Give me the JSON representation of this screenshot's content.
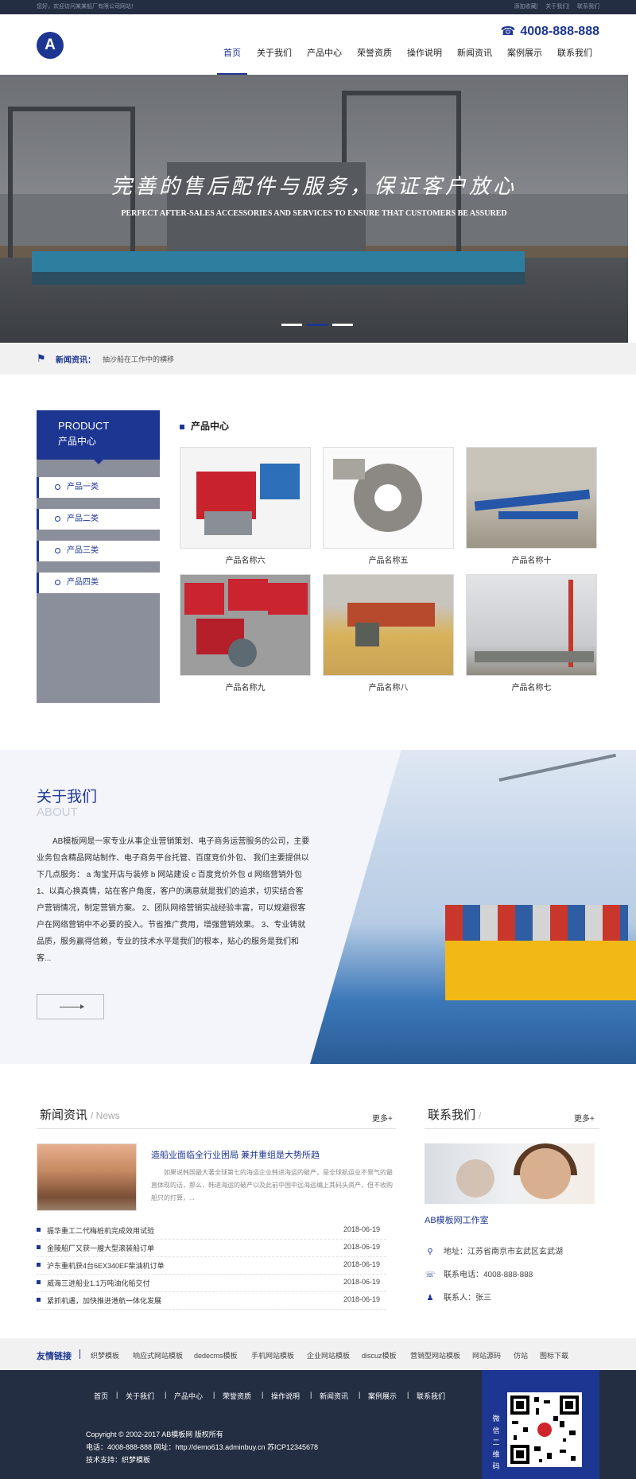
{
  "topbar": {
    "welcome": "您好，欢迎访问某某船厂有限公司网站！",
    "links": [
      "添加收藏",
      "关于我们",
      "联系我们"
    ]
  },
  "header": {
    "logo": "A",
    "phone": "4008-888-888",
    "phone_icon": "phone-icon",
    "nav": [
      "首页",
      "关于我们",
      "产品中心",
      "荣誉资质",
      "操作说明",
      "新闻资讯",
      "案例展示",
      "联系我们"
    ],
    "active_nav": "首页"
  },
  "banner": {
    "slogan": "完善的售后配件与服务，保证客户放心",
    "english": "PERFECT AFTER-SALES ACCESSORIES AND SERVICES TO ENSURE THAT CUSTOMERS BE ASSURED",
    "dots": 3,
    "current_dot": 2
  },
  "ticker": {
    "label": "新闻资讯：",
    "text": "抽沙船在工作中的横移",
    "icon": "tag-icon"
  },
  "sidebar": {
    "title_en": "PRODUCT",
    "title_zh": "产品中心",
    "categories": [
      "产品一类",
      "产品二类",
      "产品三类",
      "产品四类"
    ]
  },
  "products": {
    "title": "产品中心",
    "items": [
      "产品名称六",
      "产品名称五",
      "产品名称十",
      "产品名称九",
      "产品名称八",
      "产品名称七"
    ]
  },
  "about": {
    "title": "关于我们",
    "subtitle": "ABOUT",
    "text": "AB模板网是一家专业从事企业营销策划、电子商务运营服务的公司，主要业务包含精品网站制作、电子商务平台托管、百度竞价外包、 我们主要提供以下几点服务： a 淘宝开店与装修 b 网站建设 c 百度竞价外包 d 网络营销外包 1、以真心换真情，站在客户角度，客户的满意就是我们的追求，切实结合客户营销情况，制定营销方案。 2、团队网络营销实战经验丰富，可以规避很客户在网络营销中不必要的投入。节省推广费用，增强营销效果。 3、专业铸就品质，服务赢得信赖，专业的技术水平是我们的根本，贴心的服务是我们和客..."
  },
  "news": {
    "title": "新闻资讯",
    "subtitle": "/ News",
    "more": "更多+",
    "featured_title": "造船业面临全行业困局 兼并重组是大势所趋",
    "featured_desc": "如果说韩国最大著全球第七的海运企业韩进海运的破产，是全球航运业不景气的最直体现的话，那么，韩进海运的破产以及此前中国中远海运编上其码头资产，但不收购船只的打算，...",
    "list": [
      {
        "title": "振华重工二代梅桩机完成效用试验",
        "date": "2018-06-19"
      },
      {
        "title": "金陵船厂又获一艘大型滚装船订单",
        "date": "2018-06-19"
      },
      {
        "title": "沪东重机获4台6EX340EF柴油机订单",
        "date": "2018-06-19"
      },
      {
        "title": "威海三进船业1.1万吨油化船交付",
        "date": "2018-06-19"
      },
      {
        "title": "紧抓机遇，加快推进港航一体化发展",
        "date": "2018-06-19"
      }
    ]
  },
  "contact": {
    "title": "联系我们",
    "subtitle": "/",
    "more": "更多+",
    "company": "AB模板网工作室",
    "address": "地址：江苏省南京市玄武区玄武湖",
    "phone": "联系电话：4008-888-888",
    "person": "联系人：张三",
    "icons": [
      "map-pin-icon",
      "phone-icon",
      "user-icon"
    ]
  },
  "links": {
    "title": "友情链接",
    "items": [
      "织梦模板",
      "响应式网站模板",
      "dedecms模板",
      "手机网站模板",
      "企业网站模板",
      "discuz模板",
      "营销型网站模板",
      "网站源码",
      "仿站",
      "图标下载"
    ]
  },
  "footer": {
    "nav": [
      "首页",
      "关于我们",
      "产品中心",
      "荣誉资质",
      "操作说明",
      "新闻资讯",
      "案例展示",
      "联系我们"
    ],
    "copyright": "Copyright © 2002-2017 AB模板网 版权所有",
    "contact_line": "电话：4008-888-888 网址：http://demo613.adminbuy.cn 苏ICP12345678",
    "support": "技术支持：织梦模板",
    "qr_label": "微信二维码"
  },
  "colors": {
    "brand": "#1d3691",
    "dark": "#242e42"
  }
}
